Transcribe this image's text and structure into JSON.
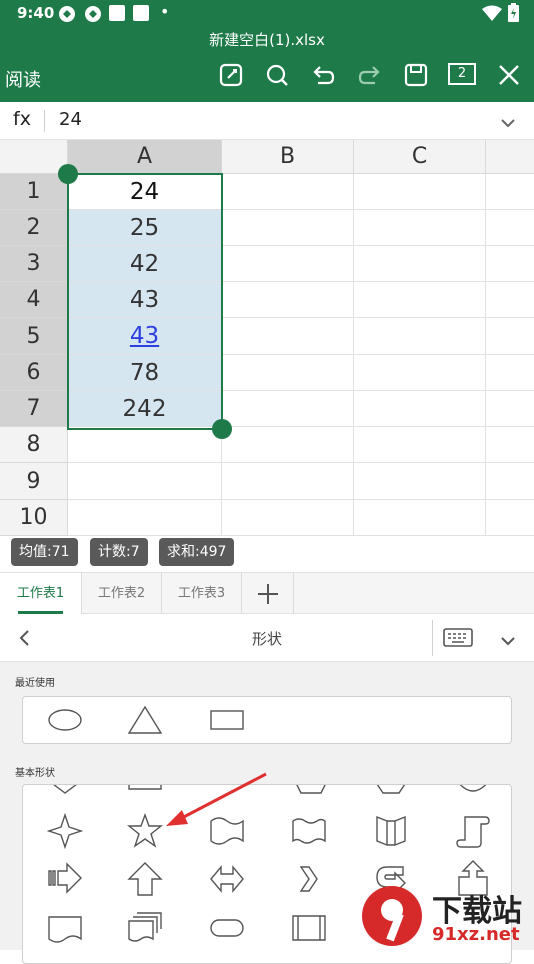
{
  "status_bar": {
    "time": "9:40",
    "notification_glyph": "•"
  },
  "title_bar": {
    "file_name": "新建空白(1).xlsx",
    "mode_label": "阅读",
    "window_count": "2"
  },
  "formula_bar": {
    "fx_label": "fx",
    "value": "24"
  },
  "grid": {
    "columns": [
      "A",
      "B",
      "C"
    ],
    "rows": [
      "1",
      "2",
      "3",
      "4",
      "5",
      "6",
      "7",
      "8",
      "9",
      "10"
    ],
    "column_a_values": [
      "24",
      "25",
      "42",
      "43",
      "43",
      "78",
      "242"
    ]
  },
  "stats": {
    "average": "均值:71",
    "count": "计数:7",
    "sum": "求和:497"
  },
  "sheet_tabs": [
    "工作表1",
    "工作表2",
    "工作表3"
  ],
  "panel": {
    "title": "形状",
    "recent_label": "最近使用",
    "basic_label": "基本形状"
  },
  "watermark": {
    "text": "下载站",
    "site": "91xz.net"
  },
  "colors": {
    "accent": "#1f7a4a",
    "selection": "#d6e6f1",
    "link": "#2c3fe0",
    "arrow": "#e03030"
  }
}
